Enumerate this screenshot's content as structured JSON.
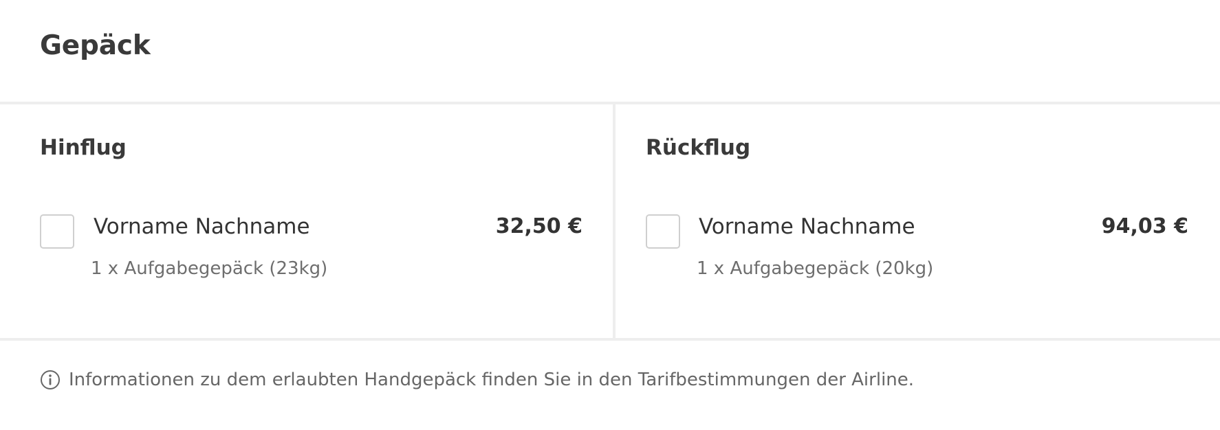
{
  "section": {
    "title": "Gepäck"
  },
  "outbound": {
    "title": "Hinflug",
    "passenger": {
      "name": "Vorname Nachname",
      "baggage": "1 x Aufgabegepäck (23kg)",
      "price": "32,50 €",
      "selected": false
    }
  },
  "return": {
    "title": "Rückflug",
    "passenger": {
      "name": "Vorname Nachname",
      "baggage": "1 x Aufgabegepäck (20kg)",
      "price": "94,03 €",
      "selected": false
    }
  },
  "info": {
    "icon": "info-icon",
    "text": "Informationen zu dem erlaubten Handgepäck finden Sie in den Tarifbestimmungen der Airline."
  },
  "colors": {
    "divider": "#eeeeee",
    "text_primary": "#333333",
    "text_secondary": "#6e6e6e",
    "checkbox_border": "#cfcfcf"
  }
}
